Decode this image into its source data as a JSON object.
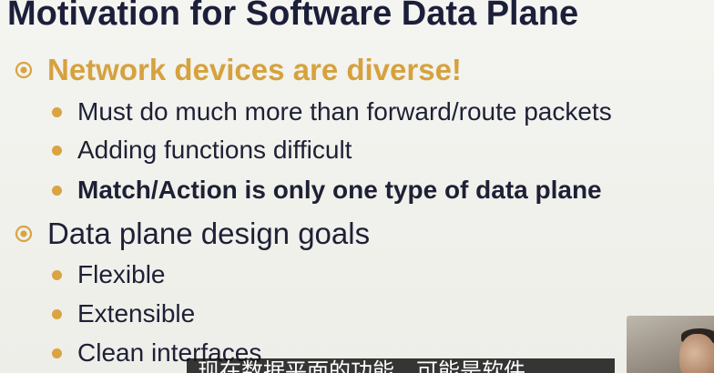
{
  "slide": {
    "title": "Motivation for Software Data Plane",
    "sections": [
      {
        "heading": "Network devices are diverse!",
        "items": [
          "Must do much more than forward/route packets",
          "Adding functions difficult",
          "Match/Action is only one type of data plane"
        ]
      },
      {
        "heading": "Data plane design goals",
        "items": [
          "Flexible",
          "Extensible",
          "Clean interfaces"
        ]
      }
    ]
  },
  "subtitle": {
    "text": "现在数据平面的功能，可能是软件"
  },
  "colors": {
    "title": "#1c1f3a",
    "accent": "#d6a23e",
    "text": "#1e2035",
    "bullet": "#d9a441",
    "background": "#f2f2ee"
  }
}
